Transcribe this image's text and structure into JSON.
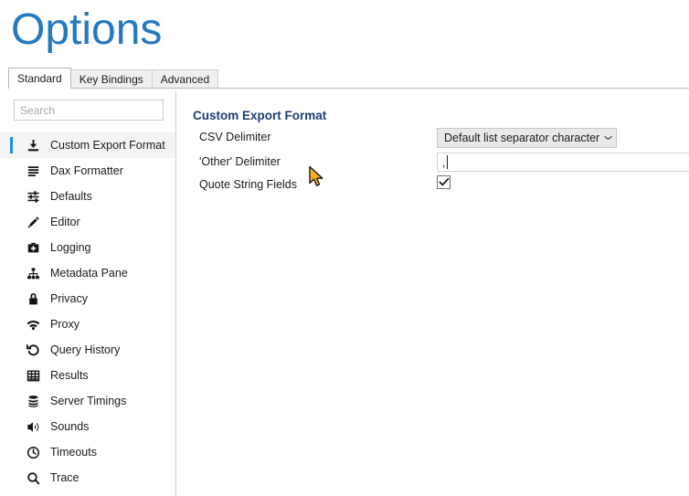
{
  "window": {
    "title": "Options"
  },
  "tabs": [
    {
      "label": "Standard",
      "active": true
    },
    {
      "label": "Key Bindings",
      "active": false
    },
    {
      "label": "Advanced",
      "active": false
    }
  ],
  "sidebar": {
    "search": {
      "placeholder": "Search",
      "value": ""
    },
    "items": [
      {
        "label": "Custom Export Format",
        "icon": "export-icon",
        "selected": true
      },
      {
        "label": "Dax Formatter",
        "icon": "lines-icon",
        "selected": false
      },
      {
        "label": "Defaults",
        "icon": "sliders-icon",
        "selected": false
      },
      {
        "label": "Editor",
        "icon": "pencil-icon",
        "selected": false
      },
      {
        "label": "Logging",
        "icon": "medical-bag-icon",
        "selected": false
      },
      {
        "label": "Metadata Pane",
        "icon": "hierarchy-icon",
        "selected": false
      },
      {
        "label": "Privacy",
        "icon": "lock-icon",
        "selected": false
      },
      {
        "label": "Proxy",
        "icon": "wifi-icon",
        "selected": false
      },
      {
        "label": "Query History",
        "icon": "history-icon",
        "selected": false
      },
      {
        "label": "Results",
        "icon": "grid-icon",
        "selected": false
      },
      {
        "label": "Server Timings",
        "icon": "database-icon",
        "selected": false
      },
      {
        "label": "Sounds",
        "icon": "speaker-icon",
        "selected": false
      },
      {
        "label": "Timeouts",
        "icon": "clock-icon",
        "selected": false
      },
      {
        "label": "Trace",
        "icon": "magnifier-icon",
        "selected": false
      }
    ]
  },
  "content": {
    "section_title": "Custom Export Format",
    "rows": {
      "csv_delimiter": {
        "label": "CSV Delimiter",
        "control": "combobox",
        "value": "Default list separator character",
        "arrow_icon": "chevron-down-icon"
      },
      "other_delimiter": {
        "label": "'Other' Delimiter",
        "control": "textbox",
        "value": ",",
        "placeholder": ""
      },
      "quote_string_fields": {
        "label": "Quote String Fields",
        "control": "checkbox",
        "checked": true,
        "check_icon": "checkmark-icon"
      }
    }
  },
  "pointer": {
    "icon": "mouse-arrow-cursor"
  },
  "colors": {
    "title_blue": "#2579c0",
    "section_navy": "#1f3c74",
    "accent_blue": "#1e90e0",
    "selected_row_bg": "#f4f4f4",
    "combo_bg": "#e9e9e9",
    "border_gray": "#c8c8c8"
  }
}
